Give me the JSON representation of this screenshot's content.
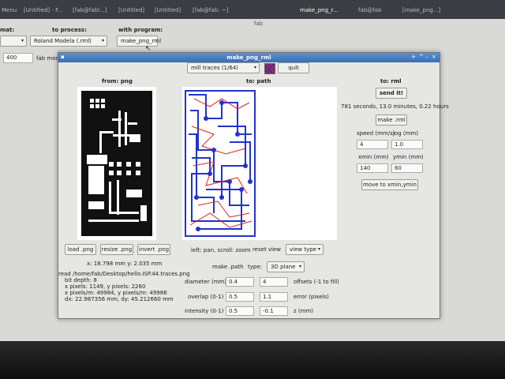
{
  "topbar": {
    "tabs": [
      "Menu",
      "[Untitled] - F...",
      "[fab@fabl...]",
      "[Untitled]",
      "[Untitled]",
      "[fab@fab: ~]",
      "make_png_r...",
      "fab@fab",
      "[make_png...]"
    ],
    "screen_title": "fab"
  },
  "background_app": {
    "format_label": "mat:",
    "process_label": "to process:",
    "program_label": "with program:",
    "process_select": "Roland Modela (.rml)",
    "program_button": "make_png_rml",
    "dpi_value": "400",
    "fab_mod_label": "fab mod"
  },
  "window": {
    "title": "make_png_rml",
    "mill_select": "mill traces (1/64)",
    "quit_label": "quit",
    "from_header": "from: png",
    "path_header": "to: path",
    "rml_header": "to: rml",
    "send_label": "send it!",
    "time_estimate": "781 seconds, 13.0 minutes, 0.22 hours",
    "make_rml_label": "make .rml",
    "speed_label": "speed (mm/s)",
    "jog_label": "jog (mm)",
    "speed_value": "4",
    "jog_value": "1.0",
    "xmin_label": "xmin (mm)",
    "ymin_label": "ymin (mm)",
    "xmin_value": "140",
    "ymin_value": "60",
    "move_label": "move to xmin,ymin",
    "load_label": "load .png",
    "resize_label": "resize .png",
    "invert_label": "invert .png",
    "nav_hint": "left: pan, scroll: zoom",
    "reset_label": "reset view",
    "view_type_label": "view type",
    "coords": "x: 18.798 mm  y: 2.035 mm",
    "info_lines": [
      "read /home/fab/Desktop/hello.ISP.44.traces.png",
      "  bit depth: 8",
      "  x pixels: 1149, y pixels: 2260",
      "  x pixels/m: 49984, y pixels/m: 49986",
      "  dx: 22.987356 mm, dy: 45.212660 mm"
    ],
    "make_path_label": "make .path",
    "type_label": "type:",
    "type_value": "3D plane",
    "diameter_label": "diameter (mm)",
    "diameter_value": "0.4",
    "offsets_count": "4",
    "offsets_label": "offsets (-1 to fill)",
    "overlap_label": "overlap (0-1)",
    "overlap_value": "0.5",
    "error_value": "1.1",
    "error_label": "error (pixels)",
    "intensity_label": "intensity (0-1)",
    "intensity_value": "0.5",
    "z_value": "-0.1",
    "z_label": "z (mm)"
  },
  "colors": {
    "titlebar": "#3a6db4",
    "path_blue": "#2233cc",
    "path_red": "#dd2222"
  }
}
